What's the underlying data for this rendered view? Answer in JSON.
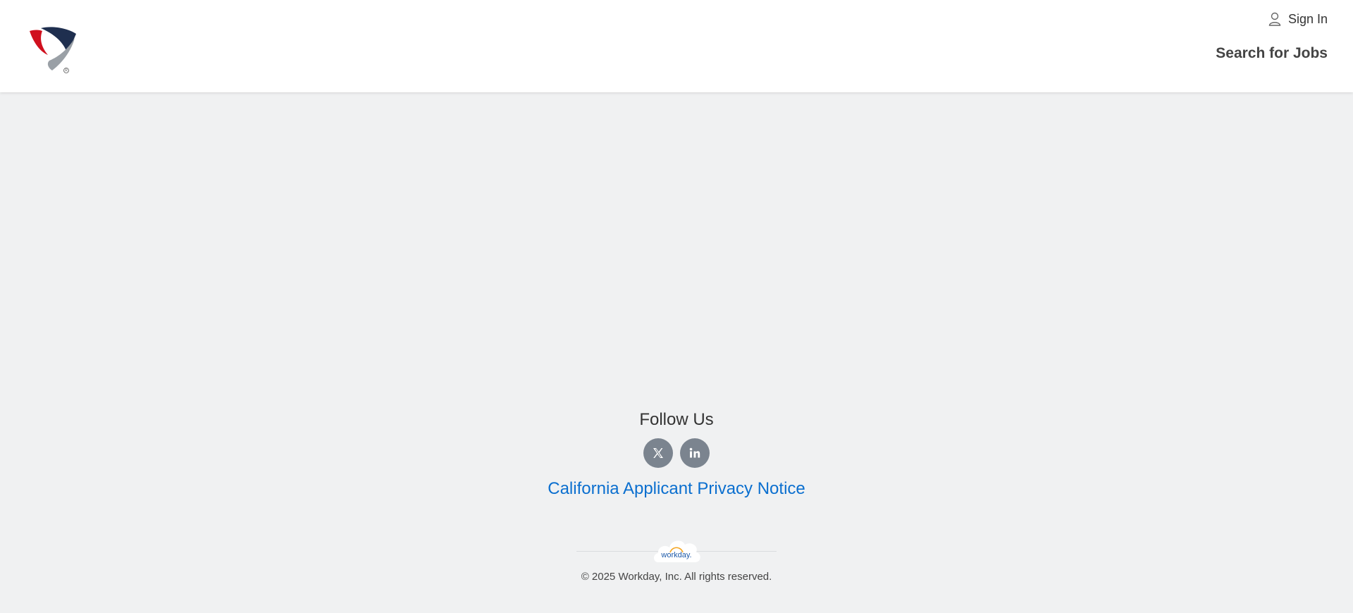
{
  "header": {
    "logo_name": "company-logo",
    "sign_in_label": "Sign In",
    "search_jobs_label": "Search for Jobs"
  },
  "footer": {
    "follow_title": "Follow Us",
    "social": [
      {
        "name": "x-icon",
        "label": "X"
      },
      {
        "name": "linkedin-icon",
        "label": "in"
      }
    ],
    "privacy_link": "California Applicant Privacy Notice",
    "powered_by_logo": "workday",
    "copyright": "© 2025 Workday, Inc. All rights reserved."
  },
  "colors": {
    "page_bg": "#f0f1f2",
    "header_bg": "#ffffff",
    "link": "#0b6fcf",
    "social_bg": "#7b848f",
    "logo_red": "#d0101e",
    "logo_navy": "#1f2f4f",
    "logo_gray": "#9aa0a6"
  }
}
